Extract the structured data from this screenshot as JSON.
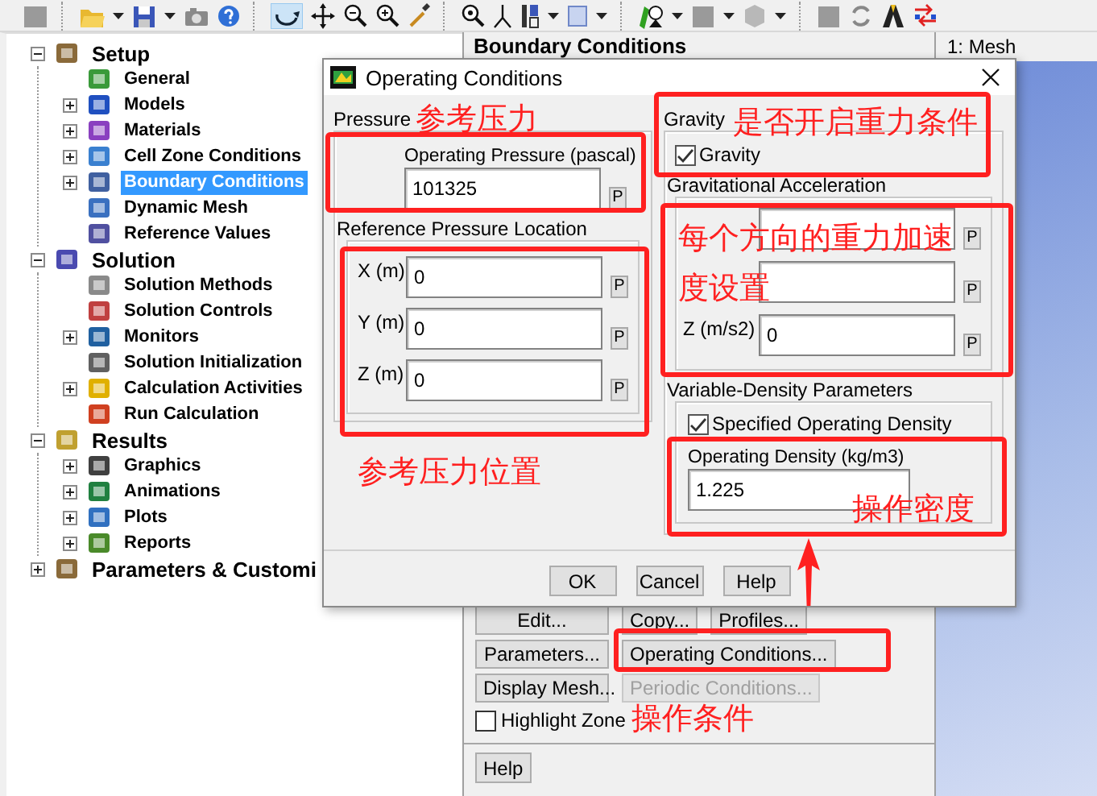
{
  "tree": [
    {
      "label": "Setup",
      "kind": "branch",
      "expanded": true,
      "selected": false,
      "children": [
        {
          "label": "General",
          "kind": "leaf",
          "selected": false
        },
        {
          "label": "Models",
          "kind": "branch",
          "expanded": false,
          "selected": false
        },
        {
          "label": "Materials",
          "kind": "branch",
          "expanded": false,
          "selected": false
        },
        {
          "label": "Cell Zone Conditions",
          "kind": "branch",
          "expanded": false,
          "selected": false
        },
        {
          "label": "Boundary Conditions",
          "kind": "branch",
          "expanded": false,
          "selected": true
        },
        {
          "label": "Dynamic Mesh",
          "kind": "leaf",
          "selected": false
        },
        {
          "label": "Reference Values",
          "kind": "leaf",
          "selected": false
        }
      ]
    },
    {
      "label": "Solution",
      "kind": "branch",
      "expanded": true,
      "selected": false,
      "children": [
        {
          "label": "Solution Methods",
          "kind": "leaf",
          "selected": false
        },
        {
          "label": "Solution Controls",
          "kind": "leaf",
          "selected": false
        },
        {
          "label": "Monitors",
          "kind": "branch",
          "expanded": false,
          "selected": false
        },
        {
          "label": "Solution Initialization",
          "kind": "leaf",
          "selected": false
        },
        {
          "label": "Calculation Activities",
          "kind": "branch",
          "expanded": false,
          "selected": false
        },
        {
          "label": "Run Calculation",
          "kind": "leaf",
          "selected": false
        }
      ]
    },
    {
      "label": "Results",
      "kind": "branch",
      "expanded": true,
      "selected": false,
      "children": [
        {
          "label": "Graphics",
          "kind": "branch",
          "expanded": false,
          "selected": false
        },
        {
          "label": "Animations",
          "kind": "branch",
          "expanded": false,
          "selected": false
        },
        {
          "label": "Plots",
          "kind": "branch",
          "expanded": false,
          "selected": false
        },
        {
          "label": "Reports",
          "kind": "branch",
          "expanded": false,
          "selected": false
        }
      ]
    },
    {
      "label": "Parameters & Customi",
      "kind": "branch",
      "expanded": false,
      "selected": false
    }
  ],
  "panel": {
    "title": "Boundary Conditions",
    "button_rows": [
      [
        {
          "label": "Edit...",
          "disabled": false
        },
        {
          "label": "Copy...",
          "disabled": false
        },
        {
          "label": "Profiles...",
          "disabled": false
        }
      ],
      [
        {
          "label": "Parameters...",
          "disabled": false
        },
        {
          "label": "Operating Conditions...",
          "disabled": false
        }
      ],
      [
        {
          "label": "Display Mesh...",
          "disabled": false
        },
        {
          "label": "Periodic Conditions...",
          "disabled": true
        }
      ]
    ],
    "highlight_zone": {
      "label": "Highlight Zone",
      "checked": false
    },
    "help": "Help"
  },
  "graphics": {
    "tab": "1: Mesh"
  },
  "dialog": {
    "title": "Operating Conditions",
    "pressure": {
      "label": "Pressure",
      "operating_pressure": {
        "label": "Operating Pressure (pascal)",
        "value": "101325",
        "p_button": "P"
      },
      "reference_location": {
        "label": "Reference Pressure Location",
        "fields": [
          {
            "label": "X (m)",
            "value": "0",
            "p_button": "P"
          },
          {
            "label": "Y (m)",
            "value": "0",
            "p_button": "P"
          },
          {
            "label": "Z (m)",
            "value": "0",
            "p_button": "P"
          }
        ]
      }
    },
    "gravity": {
      "label": "Gravity",
      "checkbox": {
        "label": "Gravity",
        "checked": true
      },
      "acceleration": {
        "label": "Gravitational Acceleration",
        "fields": [
          {
            "p_button": "P"
          },
          {
            "p_button": "P"
          },
          {
            "label": "Z (m/s2)",
            "value": "0",
            "p_button": "P"
          }
        ]
      },
      "variable_density": {
        "label": "Variable-Density Parameters",
        "checkbox": {
          "label": "Specified Operating Density",
          "checked": true
        },
        "operating_density": {
          "label": "Operating Density (kg/m3)",
          "value": "1.225"
        }
      }
    },
    "buttons": [
      "OK",
      "Cancel",
      "Help"
    ]
  },
  "annotations": [
    {
      "text": "参考压力"
    },
    {
      "text": "参考压力位置"
    },
    {
      "text": "是否开启重力条件"
    },
    {
      "text": "每个方向的重力加速度设置"
    },
    {
      "text": "操作密度"
    },
    {
      "text": "操作条件"
    }
  ]
}
